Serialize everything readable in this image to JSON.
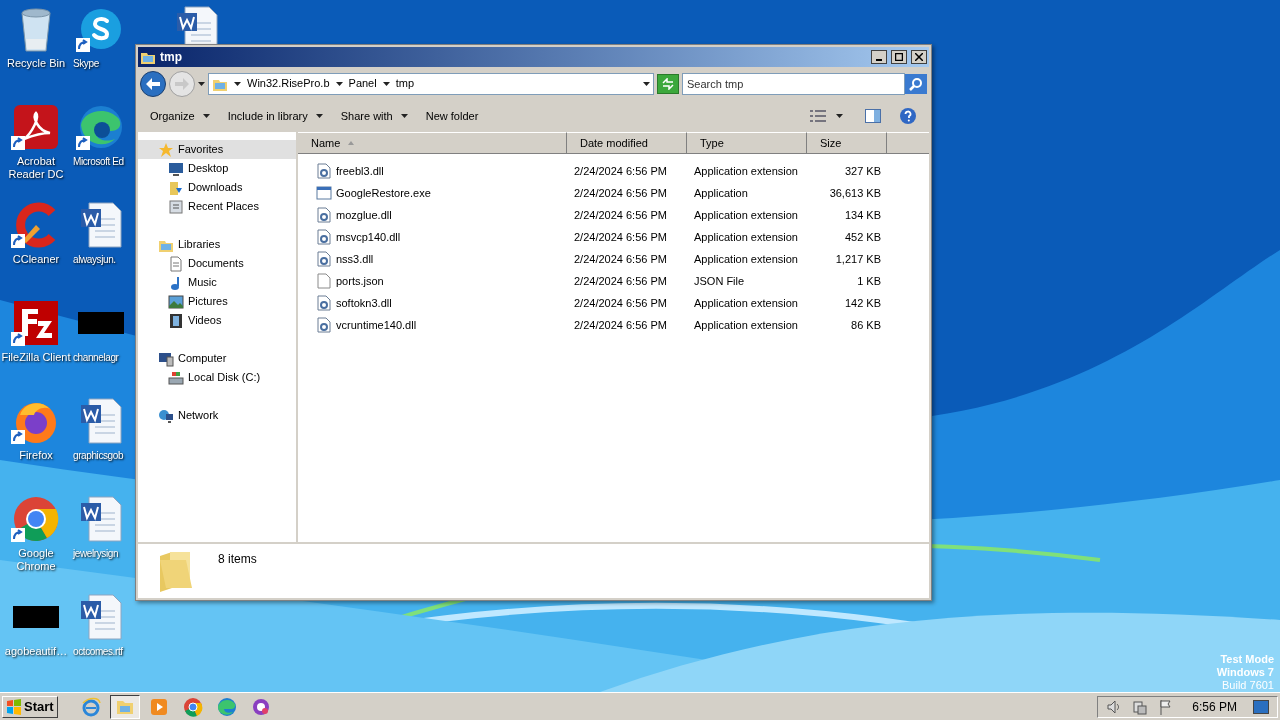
{
  "desktop_columns": [
    {
      "icons": [
        {
          "kind": "recycle",
          "label": "Recycle Bin"
        },
        {
          "kind": "acrobat",
          "label": "Acrobat Reader DC"
        },
        {
          "kind": "ccleaner",
          "label": "CCleaner"
        },
        {
          "kind": "filezilla",
          "label": "FileZilla Client"
        },
        {
          "kind": "firefox",
          "label": "Firefox"
        },
        {
          "kind": "chrome",
          "label": "Google Chrome"
        },
        {
          "kind": "redacted",
          "label": "agobeautif…"
        }
      ]
    },
    {
      "icons": [
        {
          "kind": "skype",
          "label": "Skype"
        },
        {
          "kind": "edge",
          "label": "Microsoft Ed"
        },
        {
          "kind": "word",
          "label": "alwaysjun."
        },
        {
          "kind": "redacted",
          "label": "channelagr"
        },
        {
          "kind": "word",
          "label": "graphicsgob"
        },
        {
          "kind": "word",
          "label": "jewelrysign"
        },
        {
          "kind": "word",
          "label": "octcomes.rtf"
        }
      ]
    },
    {
      "icons": [
        {
          "kind": "word"
        }
      ]
    }
  ],
  "watermark_text": [
    "Test Mode",
    "Windows 7",
    "Build 7601"
  ],
  "window": {
    "title": "tmp",
    "breadcrumb": [
      "Win32.RisePro.b",
      "Panel",
      "tmp"
    ],
    "search": {
      "placeholder": "Search tmp"
    },
    "toolbar": [
      {
        "label": "Organize",
        "dropdown": true
      },
      {
        "label": "Include in library",
        "dropdown": true
      },
      {
        "label": "Share with",
        "dropdown": true
      },
      {
        "label": "New folder",
        "dropdown": false
      }
    ],
    "sidebar": [
      {
        "kind": "star",
        "label": "Favorites",
        "selected": true,
        "children": [
          {
            "kind": "desktop",
            "label": "Desktop",
            "selected": false
          },
          {
            "kind": "downloads",
            "label": "Downloads",
            "selected": false
          },
          {
            "kind": "recent",
            "label": "Recent Places",
            "selected": false
          }
        ]
      },
      {
        "kind": "libraries",
        "label": "Libraries",
        "selected": false,
        "children": [
          {
            "kind": "documents",
            "label": "Documents",
            "selected": false
          },
          {
            "kind": "music",
            "label": "Music",
            "selected": false
          },
          {
            "kind": "pictures",
            "label": "Pictures",
            "selected": false
          },
          {
            "kind": "videos",
            "label": "Videos",
            "selected": false
          }
        ]
      },
      {
        "kind": "computer",
        "label": "Computer",
        "selected": false,
        "children": [
          {
            "kind": "disk",
            "label": "Local Disk (C:)",
            "selected": false
          }
        ]
      },
      {
        "kind": "network",
        "label": "Network",
        "selected": false
      }
    ],
    "columns": [
      {
        "label": "Name",
        "sorted": true
      },
      {
        "label": "Date modified",
        "sorted": false
      },
      {
        "label": "Type",
        "sorted": false
      },
      {
        "label": "Size",
        "sorted": false
      }
    ],
    "files": [
      {
        "kind": "dll",
        "name": "freebl3.dll",
        "date": "2/24/2024 6:56 PM",
        "type": "Application extension",
        "size": "327 KB"
      },
      {
        "kind": "exe",
        "name": "GoogleRestore.exe",
        "date": "2/24/2024 6:56 PM",
        "type": "Application",
        "size": "36,613 KB"
      },
      {
        "kind": "dll",
        "name": "mozglue.dll",
        "date": "2/24/2024 6:56 PM",
        "type": "Application extension",
        "size": "134 KB"
      },
      {
        "kind": "dll",
        "name": "msvcp140.dll",
        "date": "2/24/2024 6:56 PM",
        "type": "Application extension",
        "size": "452 KB"
      },
      {
        "kind": "dll",
        "name": "nss3.dll",
        "date": "2/24/2024 6:56 PM",
        "type": "Application extension",
        "size": "1,217 KB"
      },
      {
        "kind": "file",
        "name": "ports.json",
        "date": "2/24/2024 6:56 PM",
        "type": "JSON File",
        "size": "1 KB"
      },
      {
        "kind": "dll",
        "name": "softokn3.dll",
        "date": "2/24/2024 6:56 PM",
        "type": "Application extension",
        "size": "142 KB"
      },
      {
        "kind": "dll",
        "name": "vcruntime140.dll",
        "date": "2/24/2024 6:56 PM",
        "type": "Application extension",
        "size": "86 KB"
      }
    ],
    "status": "8 items"
  },
  "taskbar": {
    "start": "Start",
    "items": [
      {
        "kind": "ie",
        "selected": false
      },
      {
        "kind": "explorer",
        "selected": true
      },
      {
        "kind": "media",
        "selected": false
      },
      {
        "kind": "chrome",
        "selected": false
      },
      {
        "kind": "edge",
        "selected": false
      },
      {
        "kind": "app",
        "selected": false
      }
    ],
    "clock": "6:56 PM"
  }
}
